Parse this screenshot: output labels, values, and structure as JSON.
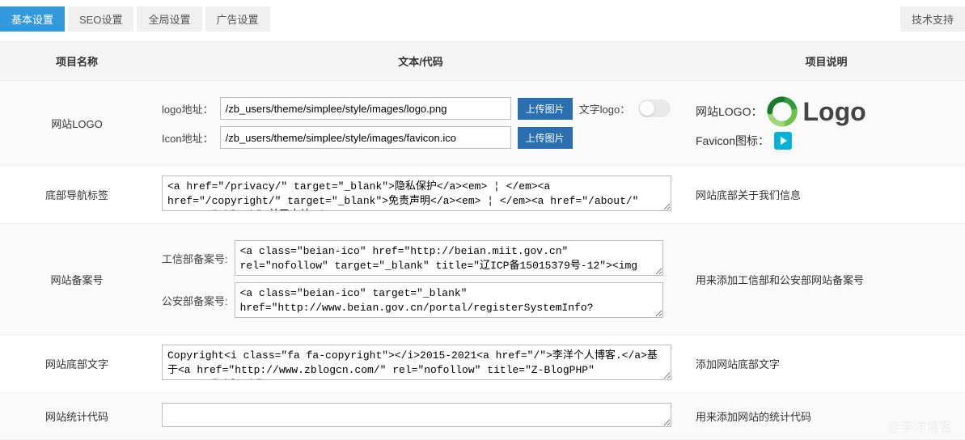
{
  "tabs": {
    "basic": "基本设置",
    "seo": "SEO设置",
    "global": "全局设置",
    "ads": "广告设置",
    "support": "技术支持"
  },
  "table": {
    "header_name": "项目名称",
    "header_code": "文本/代码",
    "header_desc": "项目说明"
  },
  "rows": {
    "logo": {
      "name": "网站LOGO",
      "logo_label": "logo地址：",
      "logo_value": "/zb_users/theme/simplee/style/images/logo.png",
      "icon_label": "Icon地址：",
      "icon_value": "/zb_users/theme/simplee/style/images/favicon.ico",
      "upload_btn": "上传图片",
      "text_logo_label": "文字logo：",
      "desc_logo_label": "网站LOGO：",
      "desc_logo_text": "Logo",
      "desc_fav_label": "Favicon图标："
    },
    "footer_nav": {
      "name": "底部导航标签",
      "value": "<a href=\"/privacy/\" target=\"_blank\">隐私保护</a><em> ¦ </em><a href=\"/copyright/\" target=\"_blank\">免责声明</a><em> ¦ </em><a href=\"/about/\" target=\"_blank\">关于本站</a>",
      "desc": "网站底部关于我们信息"
    },
    "beian": {
      "name": "网站备案号",
      "miit_label": "工信部备案号:",
      "miit_value": "<a class=\"beian-ico\" href=\"http://beian.miit.gov.cn\" rel=\"nofollow\" target=\"_blank\" title=\"辽ICP备15015379号-12\"><img",
      "gongan_label": "公安部备案号:",
      "gongan_value": "<a class=\"beian-ico\" target=\"_blank\" href=\"http://www.beian.gov.cn/portal/registerSystemInfo?",
      "desc": "用来添加工信部和公安部网站备案号"
    },
    "footer_text": {
      "name": "网站底部文字",
      "value": "Copyright<i class=\"fa fa-copyright\"></i>2015-2021<a href=\"/\">李洋个人博客.</a>基于<a href=\"http://www.zblogcn.com/\" rel=\"nofollow\" title=\"Z-BlogPHP\" target=\"_blank\">Z-",
      "desc": "添加网站底部文字"
    },
    "stats": {
      "name": "网站统计代码",
      "value": "",
      "desc": "用来添加网站的统计代码"
    }
  },
  "watermark": "@李洋博客"
}
